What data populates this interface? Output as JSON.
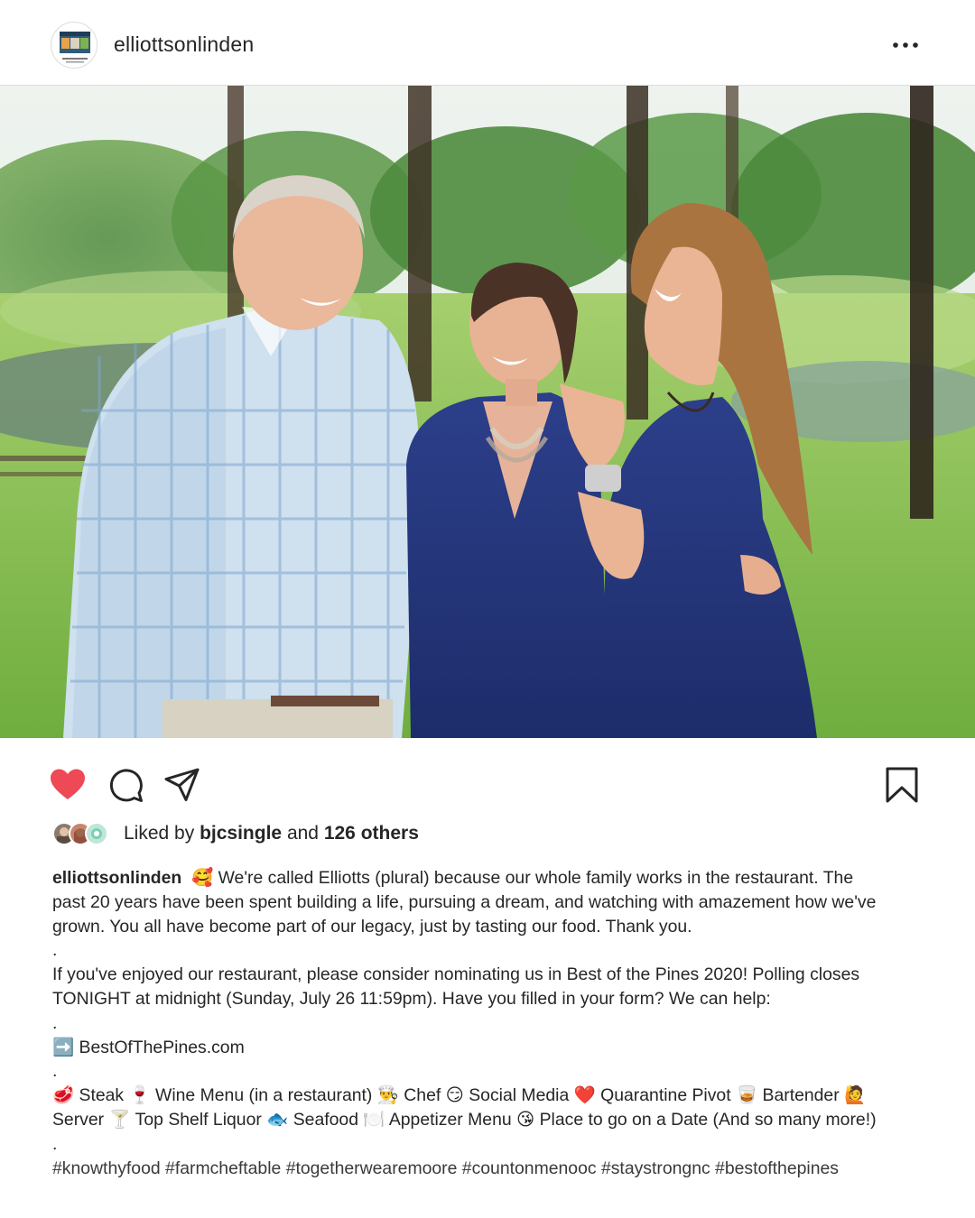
{
  "post": {
    "username": "elliottsonlinden",
    "avatar_text": "EOL",
    "avatar_sub": "ELLIOTTS",
    "photo_alt": "Three family members laughing together outdoors by a pond",
    "likes": {
      "prefix": "Liked by",
      "user": "bjcsingle",
      "middle": "and",
      "others": "126 others"
    },
    "caption": {
      "user": "elliottsonlinden",
      "lines": [
        "🥰 We're called Elliotts (plural) because our whole family works in the restaurant.  The",
        "past 20 years have been spent building a life, pursuing a dream, and watching with amazement how we've",
        "grown.  You all have become part of our legacy, just by tasting our food.  Thank you.",
        ".",
        "If you've enjoyed our restaurant, please consider nominating us in Best of the Pines 2020!  Polling closes",
        "TONIGHT at midnight (Sunday, July 26 11:59pm). Have you filled in your form? We can help:",
        ".",
        "➡️ BestOfThePines.com",
        ".",
        "🥩 Steak 🍷 Wine Menu (in a restaurant) 👨‍🍳 Chef 😏 Social Media ❤️ Quarantine Pivot 🥃 Bartender 🙋 ",
        "Server 🍸 Top Shelf Liquor 🐟 Seafood 🍽️ Appetizer Menu 😘 Place to go on a Date (And so many more!)",
        ".",
        "#knowthyfood #farmcheftable #togetherwearemoore #countonmenooc #staystrongnc #bestofthepines"
      ]
    }
  },
  "icons": {
    "more": "more-options-icon",
    "like": "heart-icon",
    "comment": "comment-icon",
    "share": "share-icon",
    "save": "bookmark-icon"
  },
  "colors": {
    "like_active": "#ed4956",
    "text": "#262626",
    "border": "#dbdbdb"
  }
}
